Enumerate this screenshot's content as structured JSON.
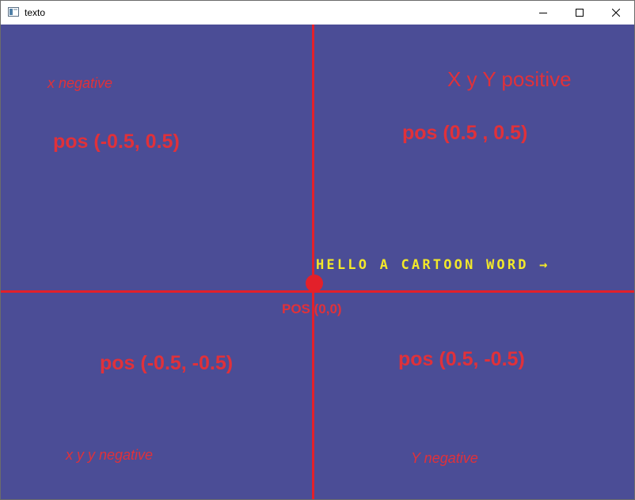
{
  "window": {
    "title": "texto"
  },
  "colors": {
    "background": "#4b4d96",
    "axis": "#e3202a",
    "label": "#e0313a",
    "cartoon_text": "#f2e82a"
  },
  "labels": {
    "x_negative": "x negative",
    "xy_positive": "X y Y positive",
    "pos_top_left": "pos  (-0.5, 0.5)",
    "pos_top_right": "pos  (0.5 , 0.5)",
    "cartoon_text": "HELLO A CARTOON WORD →",
    "origin": "POS (0,0)",
    "pos_bottom_left": "pos  (-0.5, -0.5)",
    "pos_bottom_right": "pos  (0.5, -0.5)",
    "xy_negative": "x y y negative",
    "y_negative": "Y negative"
  }
}
